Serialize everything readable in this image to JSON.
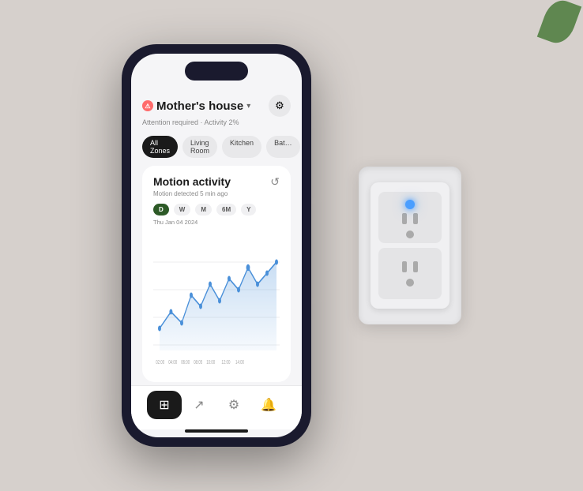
{
  "scene": {
    "leaf": "decorative-leaf"
  },
  "phone": {
    "header": {
      "alert_icon": "⚠",
      "title": "Mother's house",
      "chevron": "▾",
      "subtitle": "Attention required · Activity 2%",
      "settings_icon": "⚙"
    },
    "tabs": [
      {
        "label": "All Zones",
        "active": true
      },
      {
        "label": "Living Room",
        "active": false
      },
      {
        "label": "Kitchen",
        "active": false
      },
      {
        "label": "Bat…",
        "active": false
      }
    ],
    "motion_card": {
      "title": "Motion activity",
      "subtitle": "Motion detected 5 min ago",
      "history_icon": "↺",
      "time_ranges": [
        {
          "label": "D",
          "active": true
        },
        {
          "label": "W",
          "active": false
        },
        {
          "label": "M",
          "active": false
        },
        {
          "label": "6M",
          "active": false
        },
        {
          "label": "Y",
          "active": false
        }
      ],
      "date": "Thu Jan 04 2024",
      "chart_x_labels": [
        "02:00",
        "04:00",
        "06:00",
        "08:05",
        "10:00",
        "12:00",
        "14:00"
      ]
    },
    "bottom_nav": [
      {
        "icon": "⊞",
        "active": true
      },
      {
        "icon": "↗",
        "active": false
      },
      {
        "icon": "⚙",
        "active": false
      },
      {
        "icon": "🔔",
        "active": false
      }
    ]
  }
}
